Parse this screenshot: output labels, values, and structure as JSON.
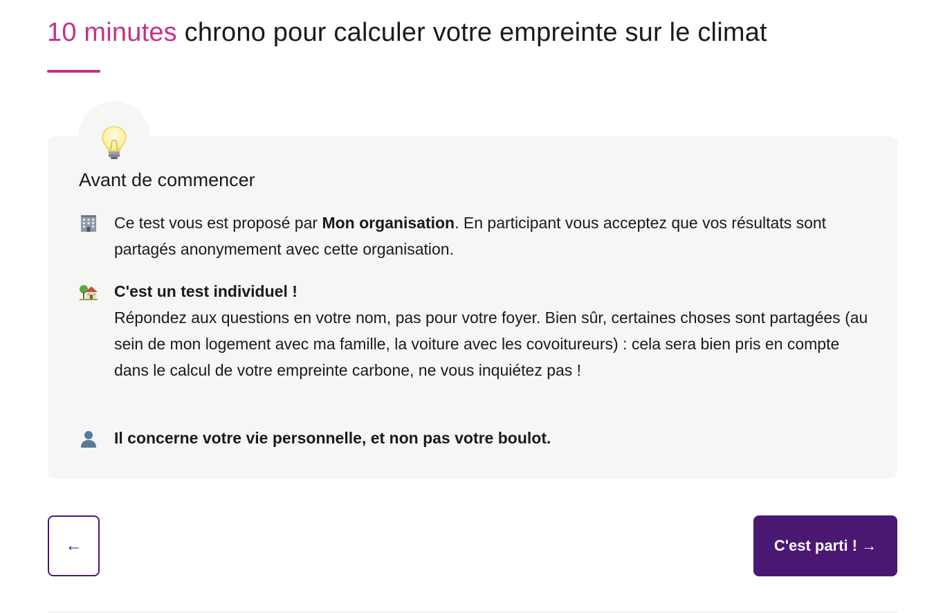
{
  "header": {
    "title_highlight": "10 minutes",
    "title_rest": " chrono pour calculer votre empreinte sur le climat",
    "accent_color": "#c4318b"
  },
  "card": {
    "icon": "light-bulb-icon",
    "title": "Avant de commencer",
    "items": [
      {
        "icon": "office-building-icon",
        "text_before": "Ce test vous est proposé par ",
        "bold": "Mon organisation",
        "text_after": ". En participant vous acceptez que vos résultats sont partagés anonymement avec cette organisation."
      },
      {
        "icon": "house-with-garden-icon",
        "bold": "C'est un test individuel !",
        "text": "Répondez aux questions en votre nom, pas pour votre foyer. Bien sûr, certaines choses sont partagées (au sein de mon logement avec ma famille, la voiture avec les covoitureurs) : cela sera bien pris en compte dans le calcul de votre empreinte carbone, ne vous inquiétez pas !"
      },
      {
        "icon": "person-silhouette-icon",
        "bold": "Il concerne votre vie personnelle, et non pas votre boulot."
      }
    ]
  },
  "navigation": {
    "back_label": "←",
    "next_label": "C'est parti ! →",
    "button_color": "#4a1873"
  }
}
